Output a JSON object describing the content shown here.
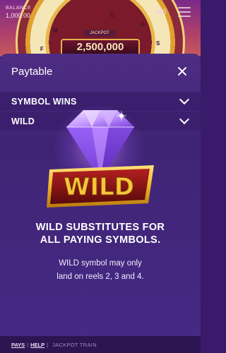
{
  "game": {
    "balance_label": "BALANCE",
    "balance_value": "1,000.00",
    "jackpot_tag": "JACKPOT",
    "jackpot_value": "2,500,000",
    "wheel_letters": [
      "F",
      "M",
      "C",
      "F",
      "S"
    ]
  },
  "panel": {
    "title": "Paytable",
    "sections": [
      {
        "label": "SYMBOL WINS"
      },
      {
        "label": "WILD"
      }
    ]
  },
  "wild": {
    "badge_text": "WILD",
    "title_line1": "WILD SUBSTITUTES FOR",
    "title_line2": "ALL PAYING SYMBOLS.",
    "body_line1": "WILD symbol may only",
    "body_line2": "land on reels 2, 3 and 4."
  },
  "footer": {
    "pays": "PAYS",
    "help": "HELP",
    "game_name": "JACKPOT TRAIN"
  },
  "colors": {
    "panel": "#452a86",
    "section_row": "#3b1f6e",
    "wild_gold": "#f6c63a",
    "diamond": "#b07cff"
  }
}
